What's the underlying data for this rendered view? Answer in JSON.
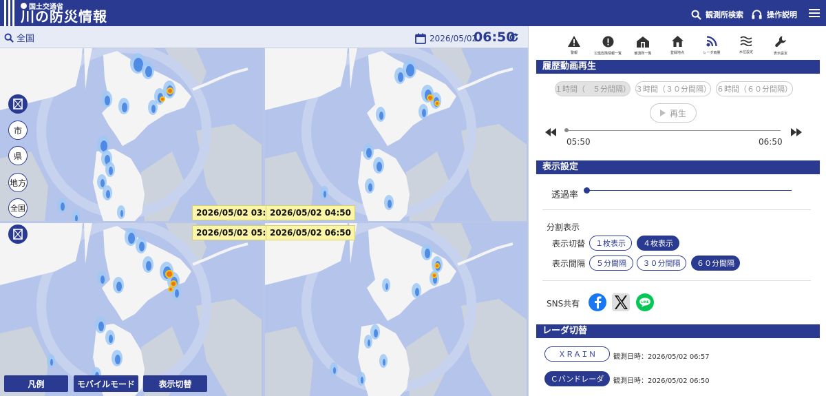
{
  "header": {
    "ministry": "国土交通省",
    "title": "川の防災情報",
    "search_label": "観測所検索",
    "help_label": "操作説明"
  },
  "mapbar": {
    "area": "全国",
    "date": "2026/05/02",
    "time": "06:50"
  },
  "panels": [
    {
      "timestamp": "2026/05/02 03:50"
    },
    {
      "timestamp": "2026/05/02 04:50"
    },
    {
      "timestamp": "2026/05/02 05:50"
    },
    {
      "timestamp": "2026/05/02 06:50"
    }
  ],
  "map_side_buttons": [
    {
      "label": "市"
    },
    {
      "label": "県"
    },
    {
      "label": "地方"
    },
    {
      "label": "全国"
    }
  ],
  "bottom_buttons": {
    "legend": "凡例",
    "mobile": "モバイルモード",
    "display_toggle": "表示切替"
  },
  "toolbar": [
    {
      "icon": "warning-icon",
      "label": "警報"
    },
    {
      "icon": "alert-icon",
      "label": "氾濫危険情報一覧"
    },
    {
      "icon": "observatory-list-icon",
      "label": "観測所一覧"
    },
    {
      "icon": "home-icon",
      "label": "登録地点"
    },
    {
      "icon": "radar-icon",
      "label": "レーダ雨量"
    },
    {
      "icon": "water-level-icon",
      "label": "水位設定"
    },
    {
      "icon": "wrench-icon",
      "label": "表示設定"
    }
  ],
  "history": {
    "heading": "履歴動画再生",
    "intervals": [
      "１時間（　５分間隔）",
      "３時間（３０分間隔）",
      "６時間（６０分間隔）"
    ],
    "play_label": "再生",
    "start_time": "05:50",
    "end_time": "06:50"
  },
  "display_settings": {
    "heading": "表示設定",
    "transparency_label": "透過率",
    "transparency_value": 0,
    "split_label": "分割表示",
    "toggle_label": "表示切替",
    "toggle_options": [
      "１枚表示",
      "４枚表示"
    ],
    "toggle_selected": "４枚表示",
    "interval_label": "表示間隔",
    "interval_options": [
      "５分間隔",
      "３０分間隔",
      "６０分間隔"
    ],
    "interval_selected": "６０分間隔",
    "sns_label": "SNS共有"
  },
  "radar_switch": {
    "heading": "レーダ切替",
    "xrain_label": "ＸＲＡＩＮ",
    "xrain_time": "観測日時：2026/05/02 06:57",
    "cband_label": "Ｃバンドレーダ",
    "cband_time": "観測日時：2026/05/02 06:50"
  },
  "colors": {
    "navy": "#2b3a91",
    "sea": "#b5c4ea",
    "land": "#f4f4f4",
    "highlight": "#fbf5a7"
  }
}
